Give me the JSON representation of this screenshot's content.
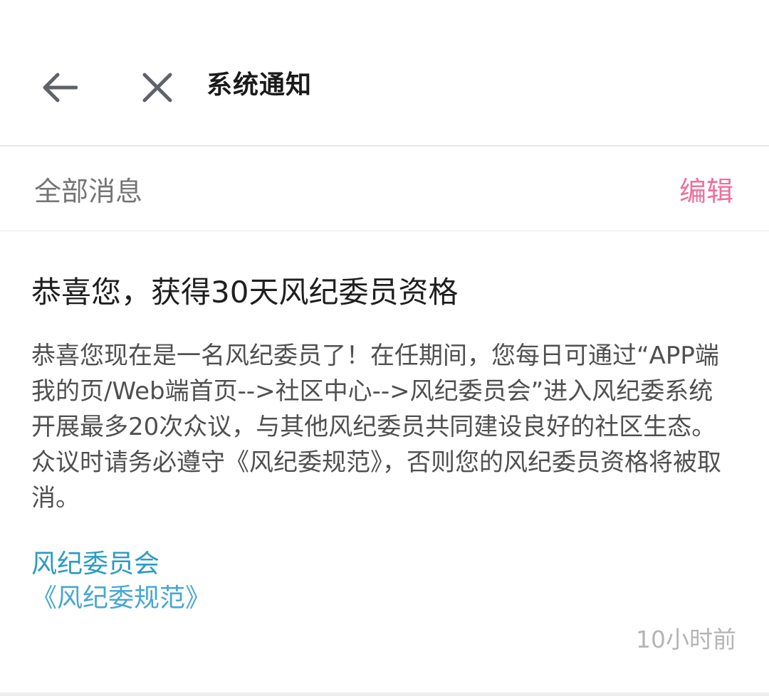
{
  "appbar": {
    "back_icon": "arrow-left-icon",
    "close_icon": "close-icon",
    "title": "系统通知"
  },
  "filter": {
    "label": "全部消息",
    "edit_label": "编辑",
    "edit_color": "#ee7099"
  },
  "message": {
    "title": "恭喜您，获得30天风纪委员资格",
    "body": "恭喜您现在是一名风纪委员了！在任期间，您每日可通过“APP端我的页/Web端首页-->社区中心-->风纪委员会”进入风纪委系统开展最多20次众议，与其他风纪委员共同建设良好的社区生态。众议时请务必遵守《风纪委规范》，否则您的风纪委员资格将被取消。",
    "links": [
      {
        "label": "风纪委员会"
      },
      {
        "label": "《风纪委规范》"
      }
    ],
    "link_color": "#2a9bc4",
    "time": "10小时前"
  }
}
